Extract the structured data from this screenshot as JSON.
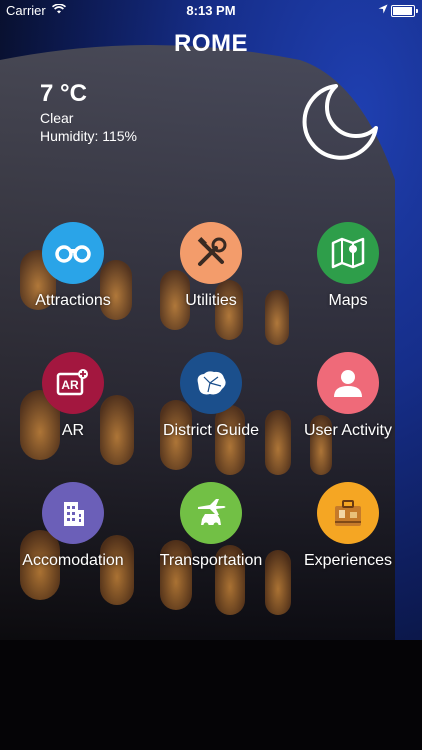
{
  "status_bar": {
    "carrier": "Carrier",
    "time": "8:13 PM"
  },
  "header": {
    "title": "ROME"
  },
  "weather": {
    "temp": "7 °C",
    "condition": "Clear",
    "humidity": "Humidity: 115%"
  },
  "menu": [
    {
      "label": "Attractions",
      "icon": "binoculars-icon",
      "color": "#2aa4e8"
    },
    {
      "label": "Utilities",
      "icon": "tools-icon",
      "color": "#f39c6b"
    },
    {
      "label": "Maps",
      "icon": "map-icon",
      "color": "#2e9e4a"
    },
    {
      "label": "AR",
      "icon": "ar-icon",
      "color": "#a3173f"
    },
    {
      "label": "District Guide",
      "icon": "district-map-icon",
      "color": "#1b4f8c"
    },
    {
      "label": "User Activity",
      "icon": "user-icon",
      "color": "#ef6a79"
    },
    {
      "label": "Accomodation",
      "icon": "hotel-icon",
      "color": "#6b5fb8"
    },
    {
      "label": "Transportation",
      "icon": "plane-car-icon",
      "color": "#72c045"
    },
    {
      "label": "Experiences",
      "icon": "suitcase-icon",
      "color": "#f5a623"
    }
  ]
}
